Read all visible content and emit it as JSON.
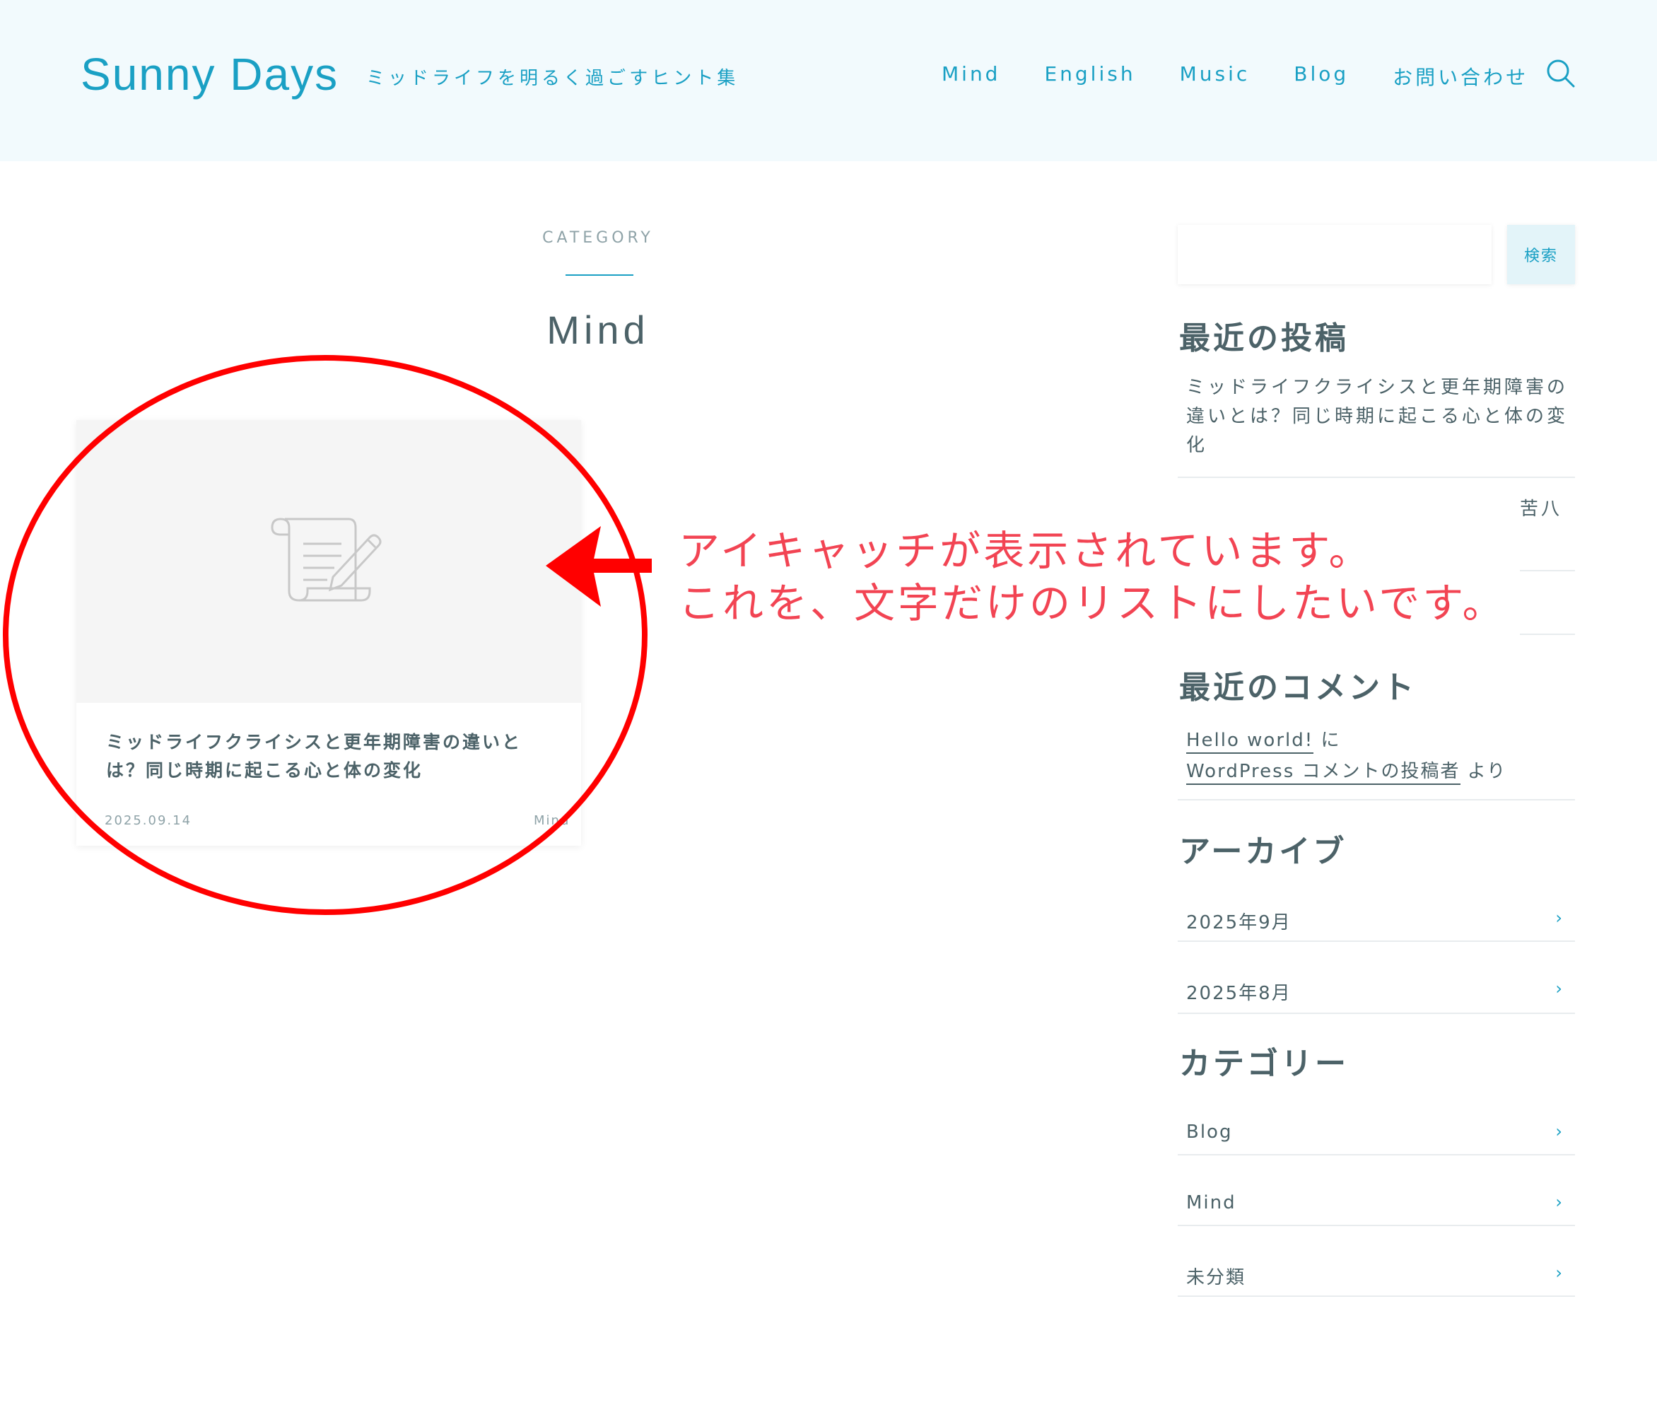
{
  "header": {
    "site_title": "Sunny Days",
    "tagline": "ミッドライフを明るく過ごすヒント集",
    "nav": [
      "Mind",
      "English",
      "Music",
      "Blog",
      "お問い合わせ"
    ]
  },
  "main": {
    "category_label": "CATEGORY",
    "category_title": "Mind",
    "post": {
      "title": "ミッドライフクライシスと更年期障害の違いとは？同じ時期に起こる心と体の変化",
      "date": "2025.09.14",
      "category": "Mind"
    }
  },
  "sidebar": {
    "search": {
      "placeholder": "",
      "button_label": "検索"
    },
    "recent_posts": {
      "title": "最近の投稿",
      "items": [
        "ミッドライフクライシスと更年期障害の違いとは？同じ時期に起こる心と体の変化",
        "苦八"
      ]
    },
    "recent_comments": {
      "title": "最近のコメント",
      "post_link": "Hello world!",
      "connector": "に",
      "author_link": "WordPress コメントの投稿者",
      "suffix": "より"
    },
    "archives": {
      "title": "アーカイブ",
      "items": [
        "2025年9月",
        "2025年8月"
      ]
    },
    "categories": {
      "title": "カテゴリー",
      "items": [
        "Blog",
        "Mind",
        "未分類"
      ]
    }
  },
  "annotation": {
    "line1": "アイキャッチが表示されています。",
    "line2": "これを、文字だけのリストにしたいです。",
    "color": "#f24453",
    "ellipse_color": "#ff0000"
  },
  "colors": {
    "accent": "#1aa0c4",
    "text": "#4c6268",
    "header_bg": "#f2fafd"
  }
}
